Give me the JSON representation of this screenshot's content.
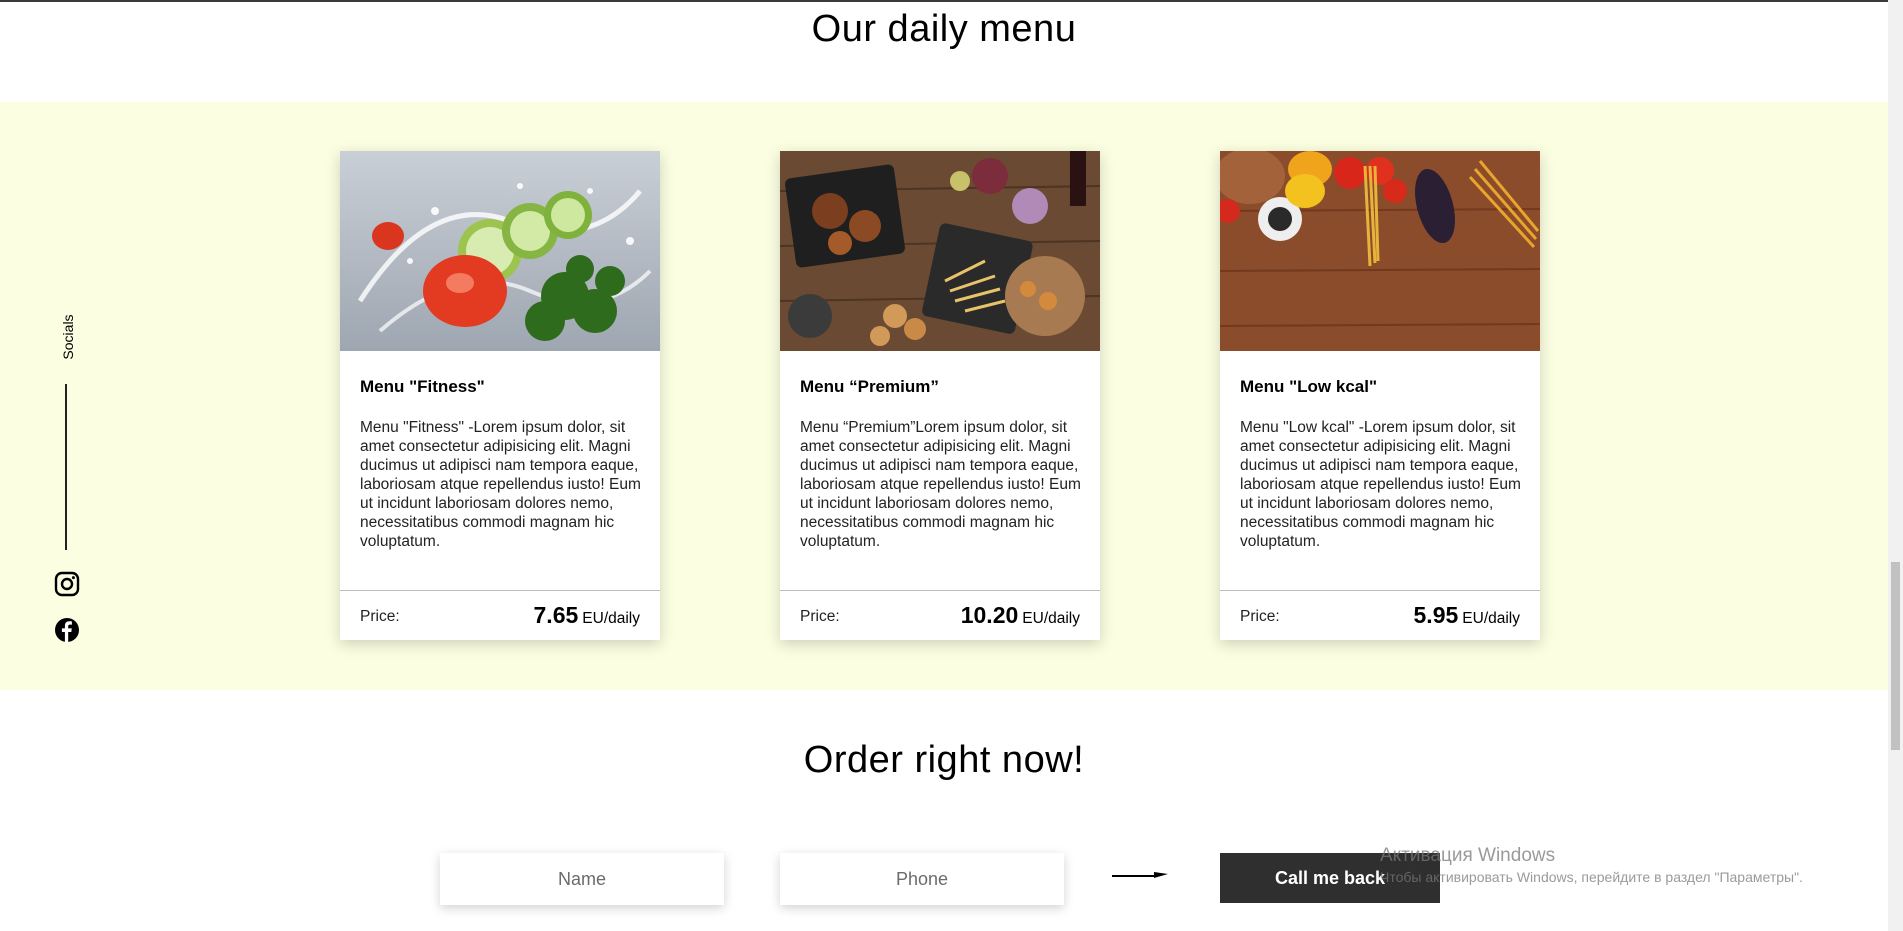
{
  "menu_section": {
    "title": "Our daily menu",
    "cards": [
      {
        "title": "Menu \"Fitness\"",
        "text": "Menu \"Fitness\" -Lorem ipsum dolor, sit amet consectetur adipisicing elit. Magni ducimus ut adipisci nam tempora eaque, laboriosam atque repellendus iusto! Eum ut incidunt laboriosam dolores nemo, necessitatibus commodi magnam hic voluptatum.",
        "price_label": "Price:",
        "price_value": "7.65",
        "price_unit": "EU/daily"
      },
      {
        "title": "Menu “Premium”",
        "text": "Menu “Premium”Lorem ipsum dolor, sit amet consectetur adipisicing elit. Magni ducimus ut adipisci nam tempora eaque, laboriosam atque repellendus iusto! Eum ut incidunt laboriosam dolores nemo, necessitatibus commodi magnam hic voluptatum.",
        "price_label": "Price:",
        "price_value": "10.20",
        "price_unit": "EU/daily"
      },
      {
        "title": "Menu \"Low kcal\"",
        "text": "Menu \"Low kcal\" -Lorem ipsum dolor, sit amet consectetur adipisicing elit. Magni ducimus ut adipisci nam tempora eaque, laboriosam atque repellendus iusto! Eum ut incidunt laboriosam dolores nemo, necessitatibus commodi magnam hic voluptatum.",
        "price_label": "Price:",
        "price_value": "5.95",
        "price_unit": "EU/daily"
      }
    ]
  },
  "socials": {
    "label": "Socials",
    "icons": [
      "instagram-icon",
      "facebook-icon"
    ]
  },
  "order_section": {
    "title": "Order right now!",
    "name_placeholder": "Name",
    "phone_placeholder": "Phone",
    "button_label": "Call me back"
  },
  "watermark": {
    "line1": "Активация Windows",
    "line2": "Чтобы активировать Windows, перейдите в раздел \"Параметры\"."
  },
  "colors": {
    "band_background": "#fbfee1",
    "button_background": "#2f2f2f"
  }
}
